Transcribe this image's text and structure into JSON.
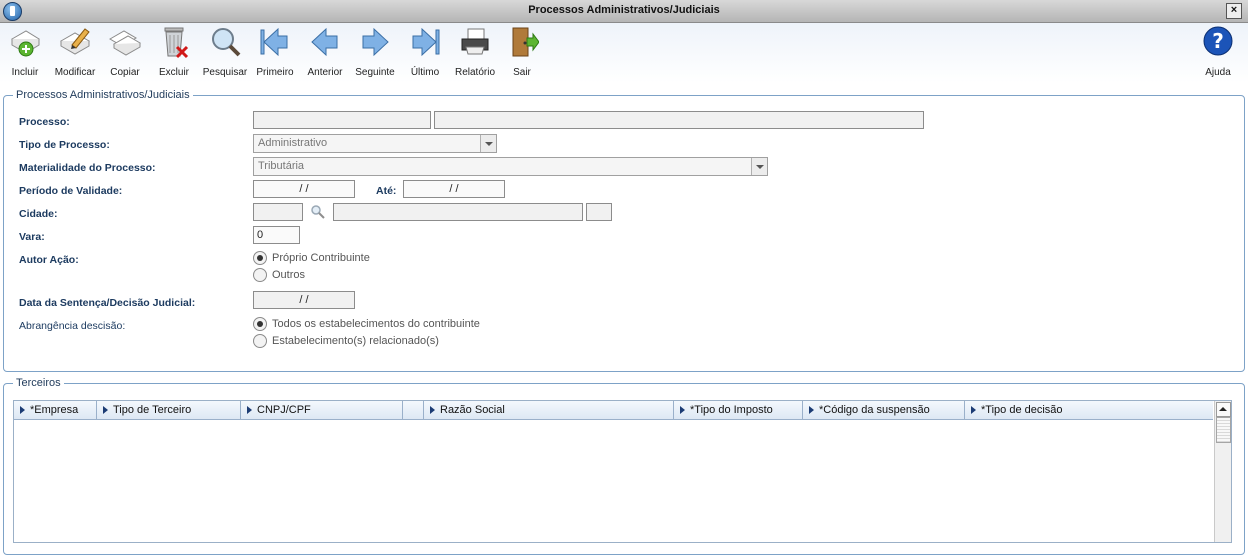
{
  "window": {
    "title": "Processos Administrativos/Judiciais",
    "close": "×"
  },
  "toolbar": {
    "items": [
      {
        "label": "Incluir",
        "icon": "add-document-icon"
      },
      {
        "label": "Modificar",
        "icon": "edit-document-icon"
      },
      {
        "label": "Copiar",
        "icon": "copy-document-icon"
      },
      {
        "label": "Excluir",
        "icon": "trash-icon"
      },
      {
        "label": "Pesquisar",
        "icon": "magnifier-icon"
      },
      {
        "label": "Primeiro",
        "icon": "first-arrow-icon"
      },
      {
        "label": "Anterior",
        "icon": "previous-arrow-icon"
      },
      {
        "label": "Seguinte",
        "icon": "next-arrow-icon"
      },
      {
        "label": "Último",
        "icon": "last-arrow-icon"
      },
      {
        "label": "Relatório",
        "icon": "printer-icon"
      },
      {
        "label": "Sair",
        "icon": "exit-door-icon"
      }
    ],
    "help_label": "Ajuda"
  },
  "form": {
    "legend": "Processos Administrativos/Judiciais",
    "processo_label": "Processo:",
    "processo_value": "",
    "processo_desc": "",
    "tipo_label": "Tipo de Processo:",
    "tipo_value": "Administrativo",
    "materialidade_label": "Materialidade do Processo:",
    "materialidade_value": "Tributária",
    "periodo_label": "Período de Validade:",
    "periodo_de": "  /  /",
    "ate_label": "Até:",
    "periodo_ate": "  /  /",
    "cidade_label": "Cidade:",
    "cidade_code": "",
    "cidade_name": "",
    "cidade_uf": "",
    "vara_label": "Vara:",
    "vara_value": "0",
    "autor_label": "Autor Ação:",
    "autor_opt1": "Próprio Contribuinte",
    "autor_opt2": "Outros",
    "sentenca_label": "Data da Sentença/Decisão Judicial:",
    "sentenca_value": "  /  /",
    "abrangencia_label": "Abrangência descisão:",
    "abrangencia_opt1": "Todos os estabelecimentos do contribuinte",
    "abrangencia_opt2": "Estabelecimento(s) relacionado(s)"
  },
  "terceiros": {
    "legend": "Terceiros",
    "columns": [
      "*Empresa",
      "Tipo de Terceiro",
      "CNPJ/CPF",
      "",
      "Razão Social",
      "*Tipo do Imposto",
      "*Código da suspensão",
      "*Tipo de decisão"
    ]
  }
}
